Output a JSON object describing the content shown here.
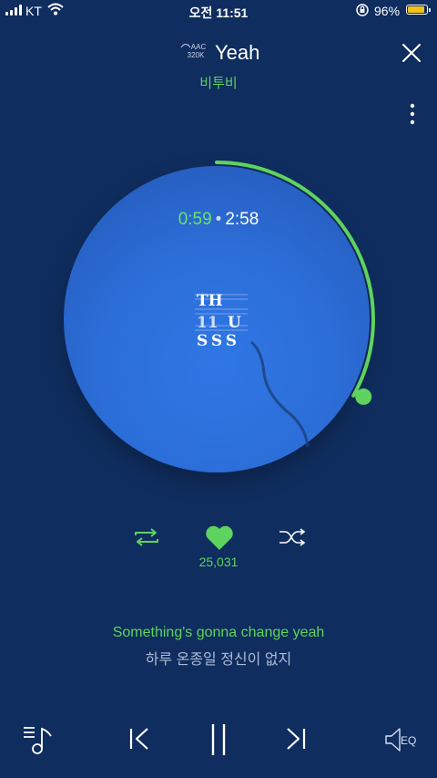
{
  "status_bar": {
    "carrier": "KT",
    "time": "오전 11:51",
    "battery_pct": "96%",
    "battery_level": 0.96,
    "battery_color": "#f3c21a"
  },
  "header": {
    "quality_codec": "AAC",
    "quality_bitrate": "320K",
    "title": "Yeah",
    "artist": "비투비"
  },
  "player": {
    "elapsed": "0:59",
    "total": "2:58",
    "progress_fraction": 0.331,
    "accent_color": "#5fd35f",
    "album_text": [
      "TH",
      "11",
      "U",
      "SSS"
    ]
  },
  "actions": {
    "likes": "25,031"
  },
  "lyrics": {
    "current": "Something's gonna change yeah",
    "next": "하루 온종일 정신이 없지"
  },
  "bottom_bar": {
    "eq_label": "EQ"
  },
  "icons": [
    "signal-icon",
    "wifi-icon",
    "lock-rotation-icon",
    "battery-icon",
    "close-icon",
    "more-icon",
    "repeat-icon",
    "heart-icon",
    "shuffle-icon",
    "playlist-icon",
    "previous-icon",
    "pause-icon",
    "next-icon",
    "equalizer-icon"
  ]
}
